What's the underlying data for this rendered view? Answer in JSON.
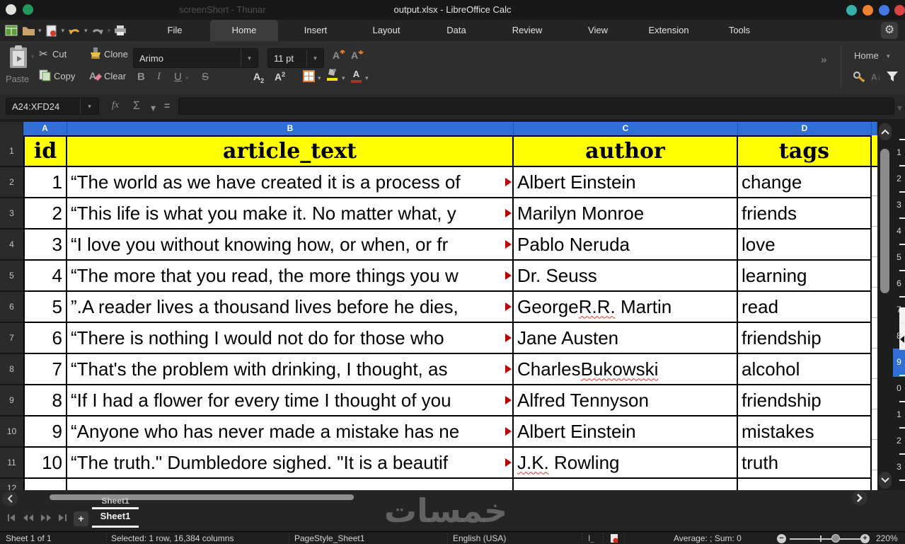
{
  "titlebar": {
    "background_title": "screenShort - Thunar",
    "title": "output.xlsx - LibreOffice Calc",
    "control_colors": [
      "#35b0ab",
      "#ee8133",
      "#4479e4",
      "#d64541"
    ]
  },
  "menubar": {
    "tabs": [
      "File",
      "Home",
      "Insert",
      "Layout",
      "Data",
      "Review",
      "View",
      "Extension",
      "Tools"
    ],
    "active_tab": "Home"
  },
  "toolbar": {
    "paste": "Paste",
    "cut": "Cut",
    "copy": "Copy",
    "clone": "Clone",
    "clear": "Clear",
    "font_name": "Arimo",
    "font_size": "11 pt",
    "bold": "B",
    "italic": "I",
    "underline": "U",
    "strike": "S",
    "letter_a": "A",
    "sub": "2",
    "sup": "2",
    "more": "»",
    "panel_label": "Home",
    "sort_az": "A↓"
  },
  "formula_bar": {
    "name_box": "A24:XFD24",
    "fx": "fx",
    "sigma": "Σ",
    "equals": "="
  },
  "glyphs": {
    "caret": "▾",
    "gear": "⚙",
    "scissors": "✂",
    "plus": "+",
    "minus": "−",
    "insert_i": "I",
    "insert_u": "_",
    "percent_zoom": "220%"
  },
  "sheet": {
    "col_letters": [
      "A",
      "B",
      "C",
      "D"
    ],
    "row_numbers": [
      "1",
      "2",
      "3",
      "4",
      "5",
      "6",
      "7",
      "8",
      "9",
      "10",
      "11",
      "12"
    ],
    "headers": [
      "id",
      "article_text",
      "author",
      "tags"
    ],
    "rows": [
      {
        "id": "1",
        "text": "“The world as we have created it is a process of",
        "author_pre": "Albert Einstein",
        "author_err": "",
        "author_post": "",
        "tag": "change"
      },
      {
        "id": "2",
        "text": "“This life is what you make it. No matter what, y",
        "author_pre": "Marilyn Monroe",
        "author_err": "",
        "author_post": "",
        "tag": "friends"
      },
      {
        "id": "3",
        "text": "“I love you without knowing how, or when, or fr",
        "author_pre": "Pablo Neruda",
        "author_err": "",
        "author_post": "",
        "tag": "love"
      },
      {
        "id": "4",
        "text": "“The more that you read, the more things you w",
        "author_pre": "Dr. Seuss",
        "author_err": "",
        "author_post": "",
        "tag": "learning"
      },
      {
        "id": "5",
        "text": "”.A reader lives a thousand lives before he dies,",
        "author_pre": "George ",
        "author_err": "R.R.",
        "author_post": " Martin",
        "tag": "read"
      },
      {
        "id": "6",
        "text": "“There is nothing I would not do for those who ",
        "author_pre": "Jane Austen",
        "author_err": "",
        "author_post": "",
        "tag": "friendship"
      },
      {
        "id": "7",
        "text": "“That's the problem with drinking, I thought, as",
        "author_pre": "Charles ",
        "author_err": "Bukowski",
        "author_post": "",
        "tag": "alcohol"
      },
      {
        "id": "8",
        "text": "“If I had a flower for every time I thought of you",
        "author_pre": "Alfred Tennyson",
        "author_err": "",
        "author_post": "",
        "tag": "friendship"
      },
      {
        "id": "9",
        "text": "“Anyone who has never made a mistake has ne",
        "author_pre": "Albert Einstein",
        "author_err": "",
        "author_post": "",
        "tag": "mistakes"
      },
      {
        "id": "10",
        "text": "“The truth.\" Dumbledore sighed. \"It is a beautif",
        "author_pre": "J.K.",
        "author_err": "",
        "author_post": " Rowling",
        "author_err2": "",
        "tag": "truth"
      }
    ]
  },
  "right_strip": {
    "digits": [
      "1",
      "2",
      "3",
      "4",
      "5",
      "6",
      "7",
      "8",
      "9",
      "0",
      "1",
      "2",
      "3"
    ],
    "selected": "9"
  },
  "sheet_tabs": {
    "ghost": "Sheet1",
    "active": "Sheet1"
  },
  "status": {
    "sheet_info": "Sheet 1 of 1",
    "selection_info": "Selected: 1 row, 16,384 columns",
    "page_style": "PageStyle_Sheet1",
    "language": "English (USA)",
    "aggregate": "Average: ; Sum: 0",
    "zoom_level": "220%"
  },
  "watermark": {
    "text": "خمسات"
  }
}
